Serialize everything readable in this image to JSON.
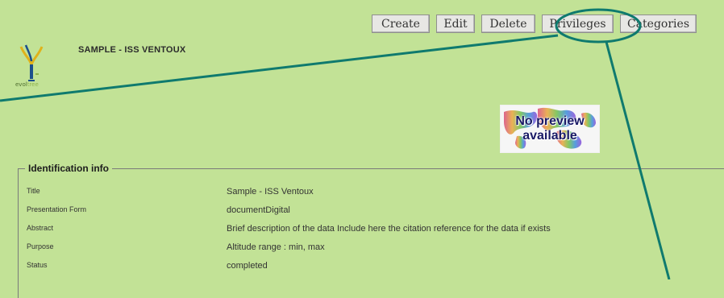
{
  "toolbar": {
    "create": "Create",
    "edit": "Edit",
    "delete": "Delete",
    "privileges": "Privileges",
    "categories": "Categories"
  },
  "header": {
    "logo_text_1": "evol",
    "logo_text_2": "tree",
    "title": "SAMPLE - ISS VENTOUX"
  },
  "preview": {
    "line1": "No preview",
    "line2": "available"
  },
  "identification": {
    "legend": "Identification info",
    "rows": [
      {
        "label": "Title",
        "value": "Sample - ISS Ventoux"
      },
      {
        "label": "Presentation Form",
        "value": "documentDigital"
      },
      {
        "label": "Abstract",
        "value": "Brief description of the data Include here the citation reference for the data if exists"
      },
      {
        "label": "Purpose",
        "value": "Altitude range : min, max"
      },
      {
        "label": "Status",
        "value": "completed"
      }
    ]
  },
  "colors": {
    "background": "#c2e296",
    "annotation": "#0f7a6e"
  }
}
